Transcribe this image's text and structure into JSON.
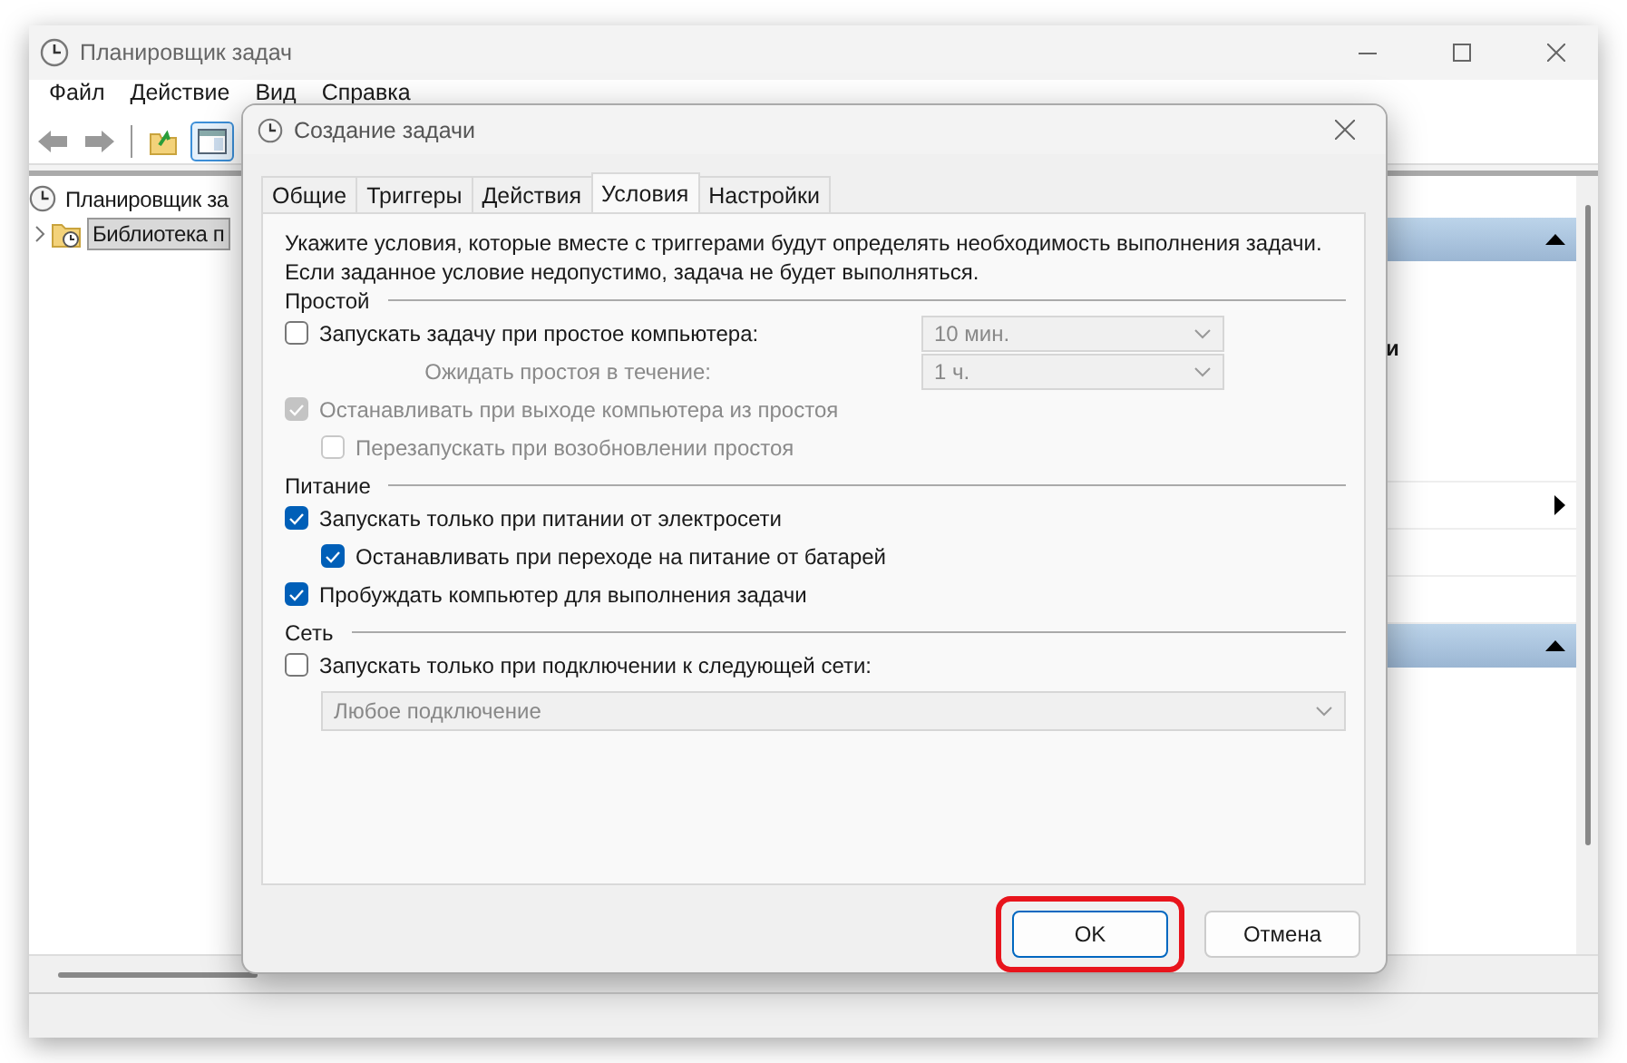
{
  "window": {
    "title": "Планировщик задач"
  },
  "menu": [
    "Файл",
    "Действие",
    "Вид",
    "Справка"
  ],
  "tree": [
    {
      "label": "Планировщик за",
      "selected": false,
      "children": [
        {
          "label": "Библиотека п",
          "selected": true,
          "expanded": false
        }
      ]
    }
  ],
  "actions_pane": {
    "fragment": "и"
  },
  "dialog": {
    "title": "Создание задачи",
    "tabs": [
      {
        "label": "Общие",
        "selected": false
      },
      {
        "label": "Триггеры",
        "selected": false
      },
      {
        "label": "Действия",
        "selected": false
      },
      {
        "label": "Условия",
        "selected": true
      },
      {
        "label": "Настройки",
        "selected": false
      }
    ],
    "intro": [
      "Укажите условия, которые вместе с триггерами будут определять необходимость выполнения задачи.",
      "Если заданное условие недопустимо, задача не будет выполняться."
    ],
    "groups": [
      {
        "title": "Простой",
        "rows": [
          {
            "kind": "checkbox",
            "label": "Запускать задачу при простое компьютера:",
            "checked": false,
            "disabled": false,
            "select": {
              "value": "10 мин.",
              "disabled": true
            }
          },
          {
            "kind": "select_row",
            "label": "Ожидать простоя в течение:",
            "disabled": true,
            "select": {
              "value": "1 ч.",
              "disabled": true
            }
          },
          {
            "kind": "checkbox",
            "label": "Останавливать при выходе компьютера из простоя",
            "checked": true,
            "disabled": true,
            "children": [
              {
                "kind": "checkbox",
                "label": "Перезапускать при возобновлении простоя",
                "checked": false,
                "disabled": true
              }
            ]
          }
        ]
      },
      {
        "title": "Питание",
        "rows": [
          {
            "kind": "checkbox",
            "label": "Запускать только при питании от электросети",
            "checked": true,
            "disabled": false,
            "children": [
              {
                "kind": "checkbox",
                "label": "Останавливать при переходе на питание от батарей",
                "checked": true,
                "disabled": false
              }
            ]
          },
          {
            "kind": "checkbox",
            "label": "Пробуждать компьютер для выполнения задачи",
            "checked": true,
            "disabled": false
          }
        ]
      },
      {
        "title": "Сеть",
        "rows": [
          {
            "kind": "checkbox",
            "label": "Запускать только при подключении к следующей сети:",
            "checked": false,
            "disabled": false
          },
          {
            "kind": "dropdown",
            "value": "Любое подключение",
            "disabled": true
          }
        ]
      }
    ],
    "buttons": [
      {
        "label": "OK",
        "highlighted": true
      },
      {
        "label": "Отмена",
        "highlighted": false
      }
    ]
  }
}
